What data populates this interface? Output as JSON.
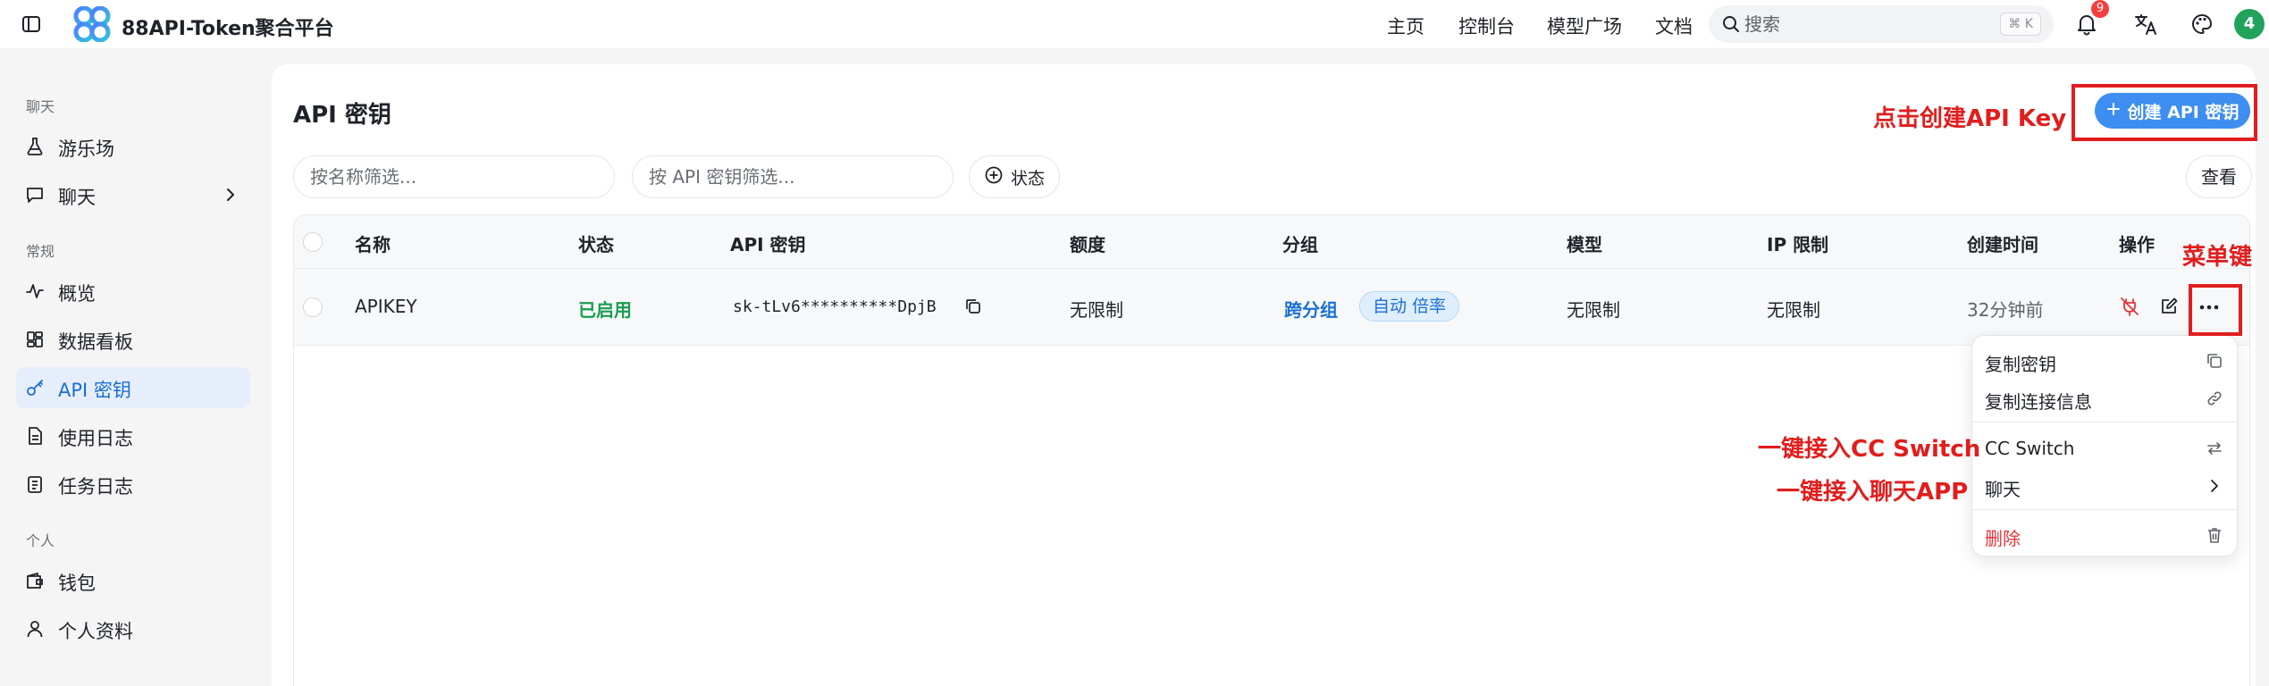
{
  "header": {
    "app_title": "88API-Token聚合平台",
    "nav": [
      "主页",
      "控制台",
      "模型广场",
      "文档"
    ],
    "search_placeholder": "搜索",
    "search_shortcut": "⌘ K",
    "notification_count": "9",
    "avatar_text": "4",
    "brand_color": "#3d8ef0"
  },
  "sidebar": {
    "sections": {
      "chat": "聊天",
      "general": "常规",
      "personal": "个人"
    },
    "items": [
      {
        "label": "游乐场",
        "icon": "flask-icon"
      },
      {
        "label": "聊天",
        "icon": "message-icon"
      },
      {
        "label": "概览",
        "icon": "activity-icon"
      },
      {
        "label": "数据看板",
        "icon": "dashboard-icon"
      },
      {
        "label": "API 密钥",
        "icon": "key-icon",
        "active": true
      },
      {
        "label": "使用日志",
        "icon": "file-icon"
      },
      {
        "label": "任务日志",
        "icon": "list-icon"
      },
      {
        "label": "钱包",
        "icon": "wallet-icon"
      },
      {
        "label": "个人资料",
        "icon": "user-icon"
      }
    ]
  },
  "main": {
    "title": "API 密钥",
    "create_button": "创建 API 密钥",
    "name_filter_placeholder": "按名称筛选...",
    "key_filter_placeholder": "按 API 密钥筛选...",
    "status_filter": "状态",
    "view_button": "查看",
    "columns": [
      "名称",
      "状态",
      "API 密钥",
      "额度",
      "分组",
      "模型",
      "IP 限制",
      "创建时间",
      "操作"
    ],
    "rows": [
      {
        "name": "APIKEY",
        "status": "已启用",
        "key": "sk-tLv6**********DpjB",
        "quota": "无限制",
        "group": "跨分组",
        "ratio": "自动 倍率",
        "models": "无限制",
        "ip_limit": "无限制",
        "created": "32分钟前"
      }
    ]
  },
  "menu": {
    "items": [
      {
        "label": "复制密钥",
        "icon": "copy-icon"
      },
      {
        "label": "复制连接信息",
        "icon": "link-icon"
      },
      {
        "label": "CC Switch",
        "icon": "switch-icon"
      },
      {
        "label": "聊天",
        "icon": "chevron-right-icon"
      },
      {
        "label": "删除",
        "icon": "trash-icon",
        "danger": true
      }
    ]
  },
  "annotations": {
    "create_hint": "点击创建API Key",
    "menu_hint": "菜单键",
    "cc_switch_hint": "一键接入CC Switch",
    "chat_app_hint": "一键接入聊天APP"
  }
}
